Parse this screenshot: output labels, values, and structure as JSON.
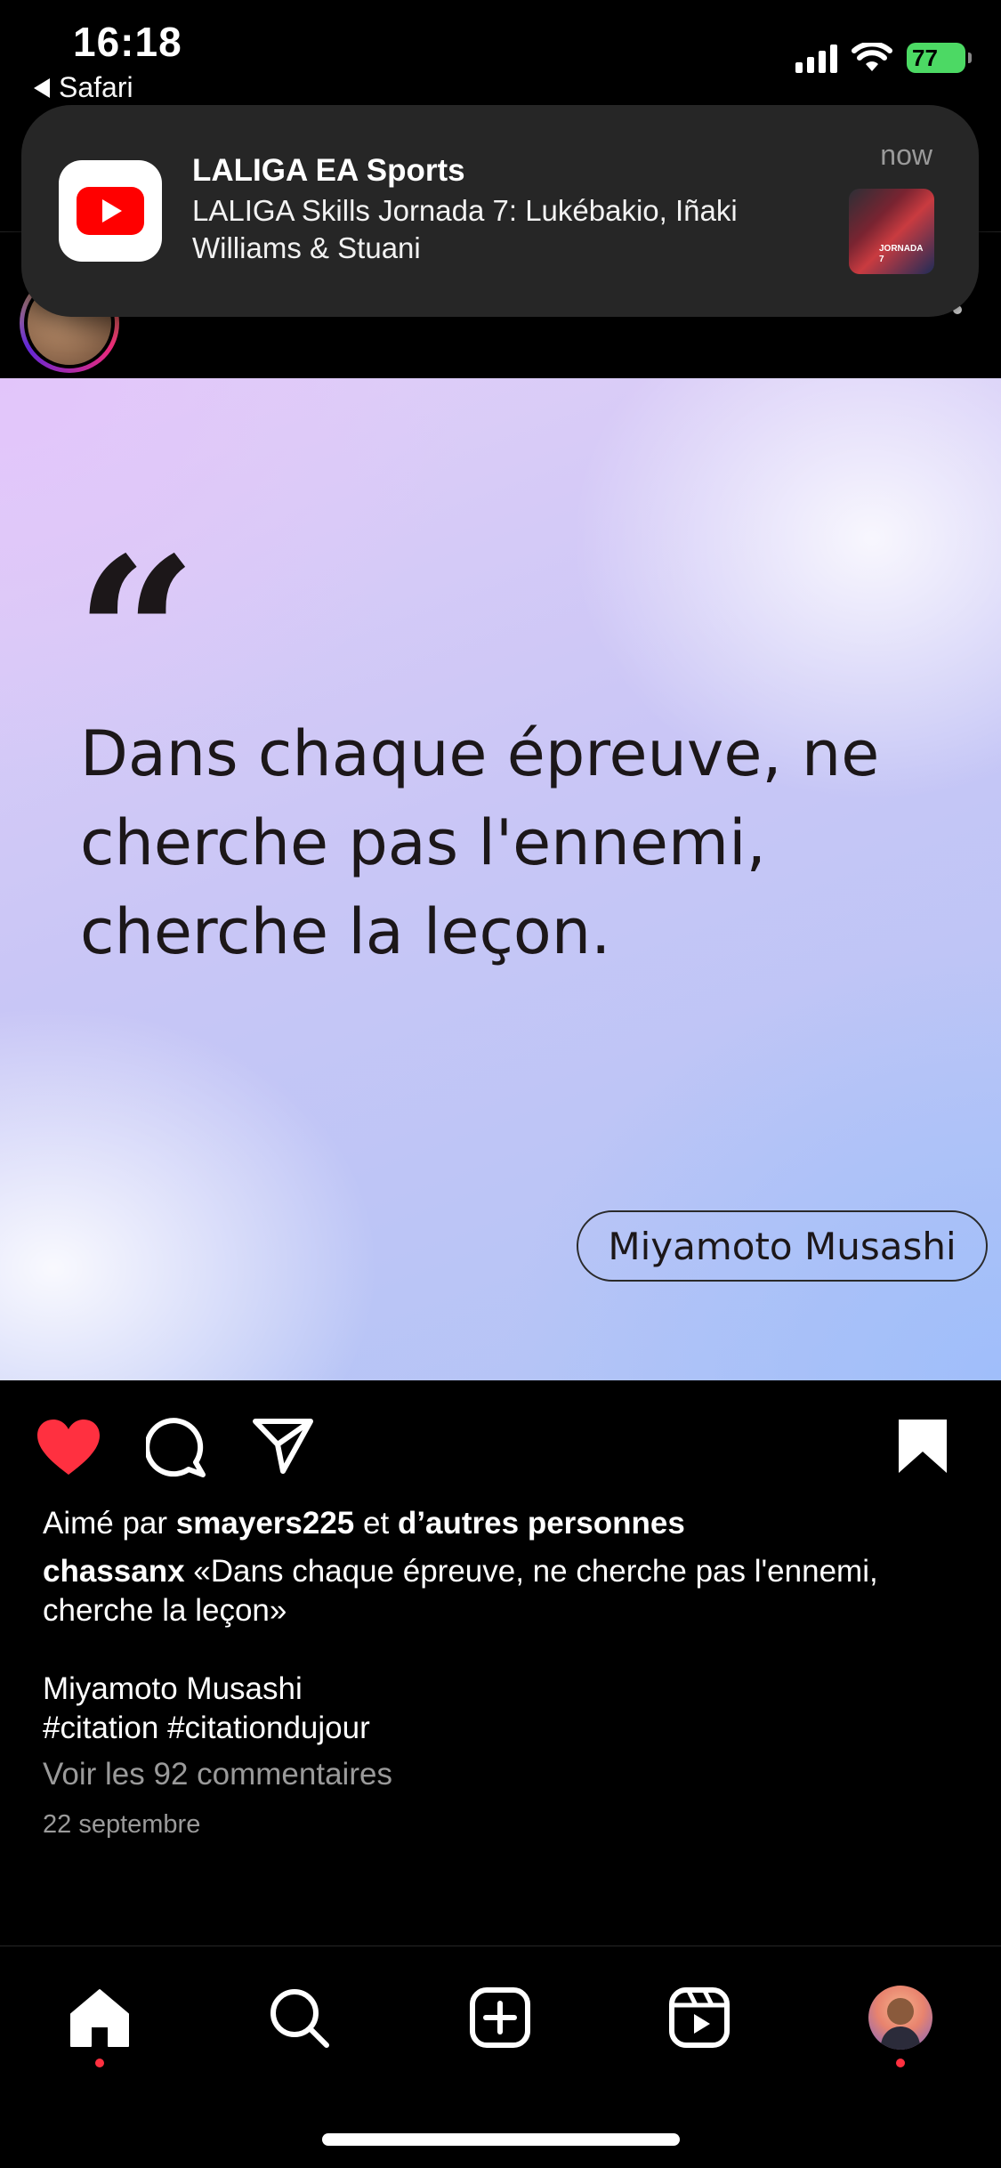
{
  "status_bar": {
    "time": "16:18",
    "back_app": "Safari",
    "battery": "77"
  },
  "notification": {
    "app": "LALIGA EA Sports",
    "message": "LALIGA Skills Jornada 7: Lukébakio, Iñaki Williams & Stuani",
    "time": "now",
    "thumb_text_1": "JORNADA",
    "thumb_text_2": "7"
  },
  "post": {
    "quote_mark": "“",
    "quote": "Dans chaque épreuve, ne cherche pas l'ennemi, cherche la leçon.",
    "author": "Miyamoto Musashi",
    "liked": true,
    "saved": true
  },
  "caption": {
    "likes_prefix": "Aimé par",
    "likes_user": "smayers225",
    "likes_mid": "et",
    "likes_others": "d’autres personnes",
    "username": "chassanx",
    "text": "«Dans chaque épreuve, ne cherche pas l'ennemi, cherche la leçon»",
    "line_author": "Miyamoto Musashi",
    "hashtags": "#citation #citationdujour",
    "comments_link": "Voir les 92 commentaires",
    "date": "22 septembre"
  },
  "icons": {
    "like": "heart-icon",
    "comment": "comment-icon",
    "share": "send-icon",
    "save": "bookmark-icon",
    "home": "home-icon",
    "search": "search-icon",
    "create": "plus-square-icon",
    "reels": "reels-icon"
  },
  "colors": {
    "like_red": "#ff3040",
    "youtube_red": "#ff0000",
    "battery_green": "#4cd964"
  }
}
